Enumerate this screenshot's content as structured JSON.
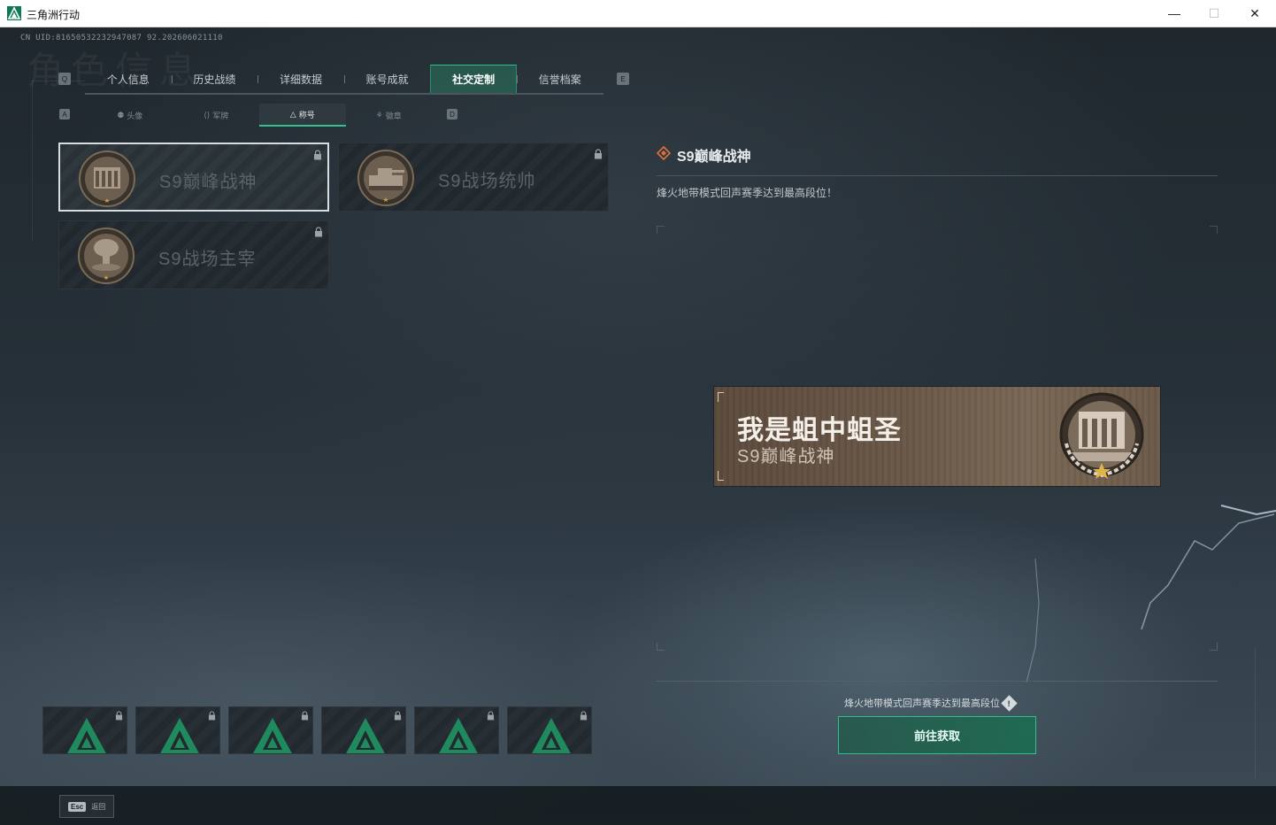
{
  "window": {
    "title": "三角洲行动",
    "minimize_glyph": "—",
    "maximize_glyph": "☐",
    "close_glyph": "✕"
  },
  "uid_text": "CN UID:81650532232947087 92.202606021110",
  "watermark": "角色信息",
  "main_tabs": {
    "prev_key": "Q",
    "next_key": "E",
    "items": [
      {
        "label": "个人信息"
      },
      {
        "label": "历史战绩"
      },
      {
        "label": "详细数据"
      },
      {
        "label": "账号成就"
      },
      {
        "label": "社交定制",
        "active": true
      },
      {
        "label": "信誉档案"
      }
    ]
  },
  "sub_tabs": {
    "prev_key": "A",
    "next_key": "D",
    "items": [
      {
        "icon": "person-icon",
        "glyph": "⚉",
        "label": "头像"
      },
      {
        "icon": "military-rank-icon",
        "glyph": "⟨⟩",
        "label": "军牌"
      },
      {
        "icon": "title-icon",
        "glyph": "△",
        "label": "称号",
        "active": true
      },
      {
        "icon": "badge-icon",
        "glyph": "⚘",
        "label": "徽章"
      }
    ]
  },
  "titles": [
    {
      "name": "S9巅峰战神",
      "locked": true,
      "selected": true,
      "medal": "fortress-medal"
    },
    {
      "name": "S9战场统帅",
      "locked": true,
      "selected": false,
      "medal": "tank-medal"
    },
    {
      "name": "S9战场主宰",
      "locked": true,
      "selected": false,
      "medal": "explosion-medal"
    }
  ],
  "detail": {
    "title": "S9巅峰战神",
    "description": "烽火地带模式回声赛季达到最高段位！",
    "requirement": "烽火地带模式回声赛季达到最高段位",
    "info_glyph": "!",
    "button_label": "前往获取"
  },
  "banner": {
    "player_name": "我是蛆中蛆圣",
    "title_name": "S9巅峰战神"
  },
  "avatar_slots": [
    {
      "locked": true
    },
    {
      "locked": true
    },
    {
      "locked": true
    },
    {
      "locked": true
    },
    {
      "locked": true
    },
    {
      "locked": true
    }
  ],
  "footer": {
    "esc_key": "Esc",
    "back_label": "返回"
  },
  "colors": {
    "accent": "#2fbf8e",
    "banner_bronze": "#6a5848"
  }
}
